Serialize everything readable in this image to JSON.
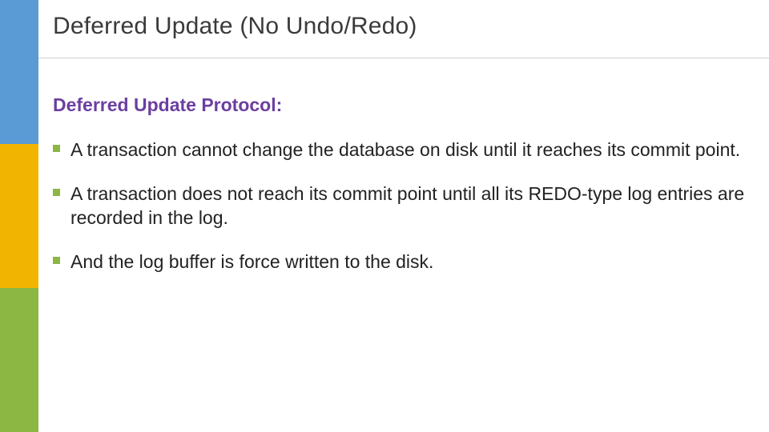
{
  "sidebar": {
    "colors": {
      "blue": "#5b9bd5",
      "yellow": "#f1b400",
      "green": "#8bb742"
    }
  },
  "slide": {
    "title": "Deferred Update (No Undo/Redo)",
    "subtitle": "Deferred Update Protocol:",
    "bullets": [
      "A transaction cannot change the database on disk until it reaches its commit point.",
      "A transaction does not reach its commit point until all its REDO-type log entries are recorded in the log.",
      "And the log buffer is force written to the disk."
    ]
  }
}
